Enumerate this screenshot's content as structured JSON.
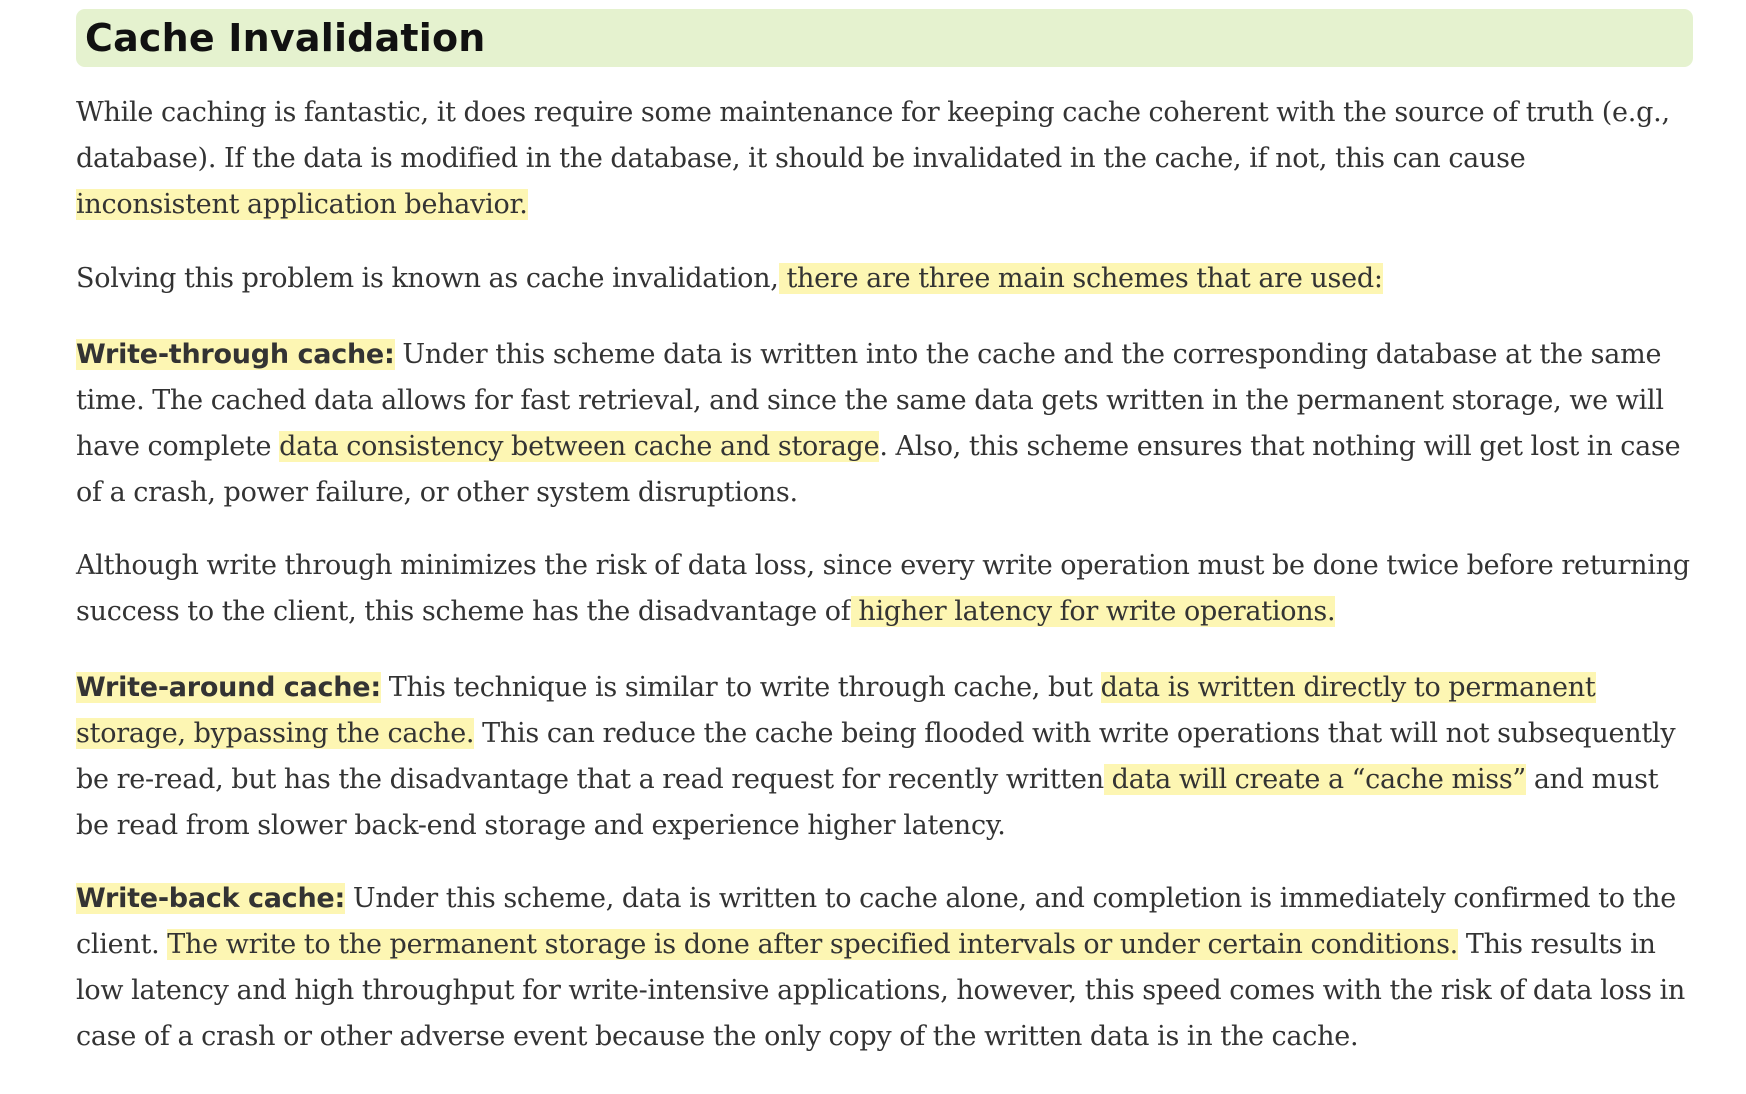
{
  "title": "Cache Invalidation",
  "paragraphs": {
    "intro": {
      "text1": "While caching is fantastic, it does require some maintenance for keeping cache coherent with the source of truth (e.g., database). If the data is modified in the database, it should be invalidated in the cache, if not, this can cause ",
      "hl1": "inconsistent application behavior."
    },
    "schemes": {
      "text1": "Solving this problem is known as cache invalidation,",
      "hl1": " there are three main schemes that are used:"
    },
    "write_through": {
      "term": "Write-through cache:",
      "text1": " Under this scheme data is written into the cache and the corresponding database at the same time. The cached data allows for fast retrieval, and since the same data gets written in the permanent storage, we will have complete ",
      "hl1": "data consistency between cache and storage",
      "text2": ". Also, this scheme ensures that nothing will get lost in case of a crash, power failure, or other system disruptions."
    },
    "write_through_cons": {
      "text1": "Although write through minimizes the risk of data loss, since every write operation must be done twice before returning success to the client, this scheme has the disadvantage of",
      "hl1": " higher latency for write operations."
    },
    "write_around": {
      "term": "Write-around cache:",
      "text1": " This technique is similar to write through cache, but ",
      "hl1": "data is written directly to permanent storage, bypassing the cache.",
      "text2": " This can reduce the cache being flooded with write operations that will not subsequently be re-read, but has the disadvantage that a read request for recently written",
      "hl2": " data will create a “cache miss”",
      "text3": " and must be read from slower back-end storage and experience higher latency."
    },
    "write_back": {
      "term": "Write-back cache:",
      "text1": " Under this scheme, data is written to cache alone, and completion is immediately confirmed to the client. ",
      "hl1": "The write to the permanent storage is done after specified intervals or under certain conditions.",
      "text2": " This results in low latency and high throughput for write-intensive applications, however, this speed comes with the risk of data loss in case of a crash or other adverse event because the only copy of the written data is in the cache."
    }
  },
  "colors": {
    "heading_background": "#e5f2cf",
    "highlight": "#fdf6b3",
    "body_text": "#333333"
  }
}
